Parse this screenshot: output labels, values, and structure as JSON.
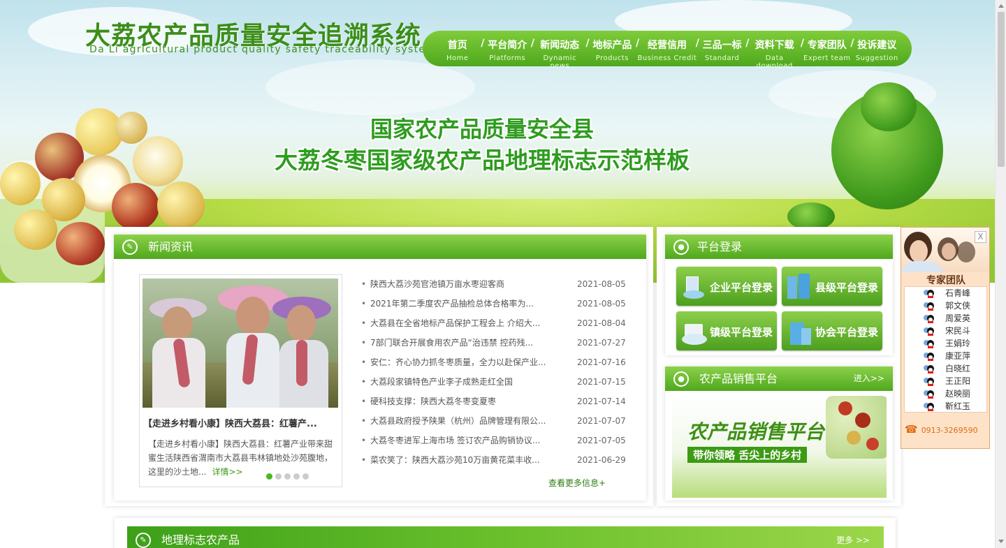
{
  "header": {
    "logo_cn": "大荔农产品质量安全追溯系统",
    "logo_en": "Da Li agricultural product quality safety traceability system"
  },
  "nav": [
    {
      "cn": "首页",
      "en": "Home"
    },
    {
      "cn": "平台简介",
      "en": "Platforms"
    },
    {
      "cn": "新闻动态",
      "en": "Dynamic news"
    },
    {
      "cn": "地标产品",
      "en": "Products"
    },
    {
      "cn": "经营信用",
      "en": "Business Credit"
    },
    {
      "cn": "三品一标",
      "en": "Standard"
    },
    {
      "cn": "资料下载",
      "en": "Data download"
    },
    {
      "cn": "专家团队",
      "en": "Expert team"
    },
    {
      "cn": "投诉建议",
      "en": "Suggestion"
    }
  ],
  "banner": {
    "line1": "国家农产品质量安全县",
    "line2": "大荔冬枣国家级农产品地理标志示范样板"
  },
  "news": {
    "title": "新闻资讯",
    "featured_title": "【走进乡村看小康】陕西大荔县：红薯产...",
    "featured_desc": "【走进乡村看小康】陕西大荔县：红薯产业带来甜蜜生活陕西省渭南市大荔县韦林镇地处沙苑腹地，这里的沙土地...",
    "featured_more": "详情>>",
    "items": [
      {
        "title": "陕西大荔沙苑官池镇万亩水枣迎客商",
        "date": "2021-08-05"
      },
      {
        "title": "2021年第二季度农产品抽检总体合格率为...",
        "date": "2021-08-05"
      },
      {
        "title": "大荔县在全省地标产品保护工程会上 介绍大...",
        "date": "2021-08-04"
      },
      {
        "title": "7部门联合开展食用农产品“治违禁 控药残...",
        "date": "2021-07-27"
      },
      {
        "title": "安仁：齐心协力抓冬枣质量，全力以赴保产业...",
        "date": "2021-07-16"
      },
      {
        "title": "大荔段家镇特色产业李子成熟走红全国",
        "date": "2021-07-15"
      },
      {
        "title": "硬科技支撑：陕西大荔冬枣变夏枣",
        "date": "2021-07-14"
      },
      {
        "title": "大荔县政府授予陕果（杭州）品牌管理有限公...",
        "date": "2021-07-07"
      },
      {
        "title": "大荔冬枣进军上海市场 签订农产品购销协议...",
        "date": "2021-07-05"
      },
      {
        "title": "菜农笑了：陕西大荔沙苑10万亩黄花菜丰收...",
        "date": "2021-06-29"
      }
    ],
    "see_more": "查看更多信息+"
  },
  "login": {
    "title": "平台登录",
    "buttons": [
      "企业平台登录",
      "县级平台登录",
      "镇级平台登录",
      "协会平台登录"
    ]
  },
  "sales": {
    "title": "农产品销售平台",
    "enter": "进入>>",
    "img_title": "农产品销售平台",
    "img_sub": "带你领略 舌尖上的乡村"
  },
  "geo": {
    "title": "地理标志农产品",
    "more": "更多 >>"
  },
  "experts": {
    "close": "X",
    "title": "专家团队",
    "names": [
      "石青峰",
      "郭文侠",
      "周爱英",
      "宋民斗",
      "王娟玲",
      "康亚萍",
      "白晓红",
      "王正阳",
      "赵映丽",
      "靳红玉"
    ],
    "phone": "0913-3269590"
  },
  "colors": {
    "accent": "#4fa81d",
    "accent_light": "#8cd14a",
    "link": "#2e7d12"
  }
}
